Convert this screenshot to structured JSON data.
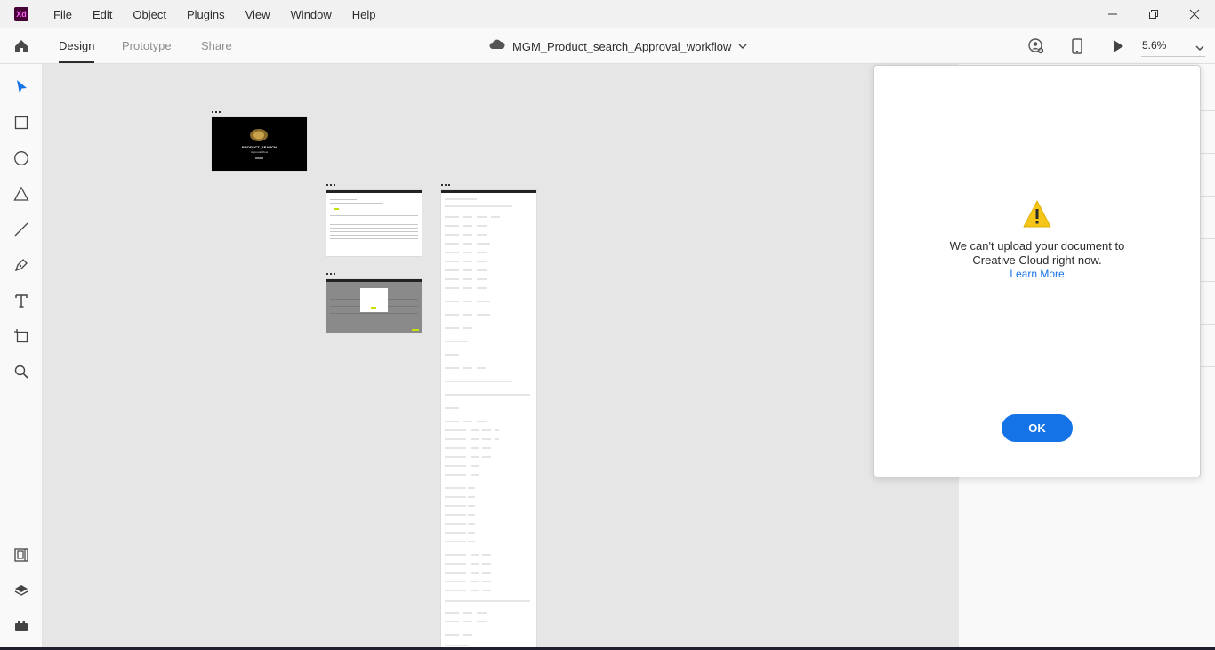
{
  "app": {
    "logo_text": "Xd",
    "brand_color": "#470137"
  },
  "menu": {
    "items": [
      "File",
      "Edit",
      "Object",
      "Plugins",
      "View",
      "Window",
      "Help"
    ]
  },
  "window_controls": [
    "minimize-icon",
    "restore-icon",
    "close-icon"
  ],
  "toolbar": {
    "tabs": [
      {
        "label": "Design",
        "active": true
      },
      {
        "label": "Prototype",
        "active": false
      },
      {
        "label": "Share",
        "active": false
      }
    ],
    "document_title": "MGM_Product_search_Approval_workflow",
    "zoom": "5.6%"
  },
  "tools": [
    "select-icon",
    "rectangle-icon",
    "ellipse-icon",
    "polygon-icon",
    "line-icon",
    "pen-icon",
    "text-icon",
    "artboard-icon",
    "zoom-icon"
  ],
  "bottom_tools": [
    "assets-icon",
    "layers-icon",
    "plugins-icon"
  ],
  "artboards": {
    "splash": {
      "title": "PRODUCT_SEARCH",
      "subtitle": "Approval Flow"
    }
  },
  "dialog": {
    "line1": "We can't upload your document to",
    "line2": "Creative Cloud right now.",
    "link": "Learn More",
    "ok_label": "OK"
  },
  "colors": {
    "accent": "#1473e6",
    "warning": "#f5c518"
  }
}
